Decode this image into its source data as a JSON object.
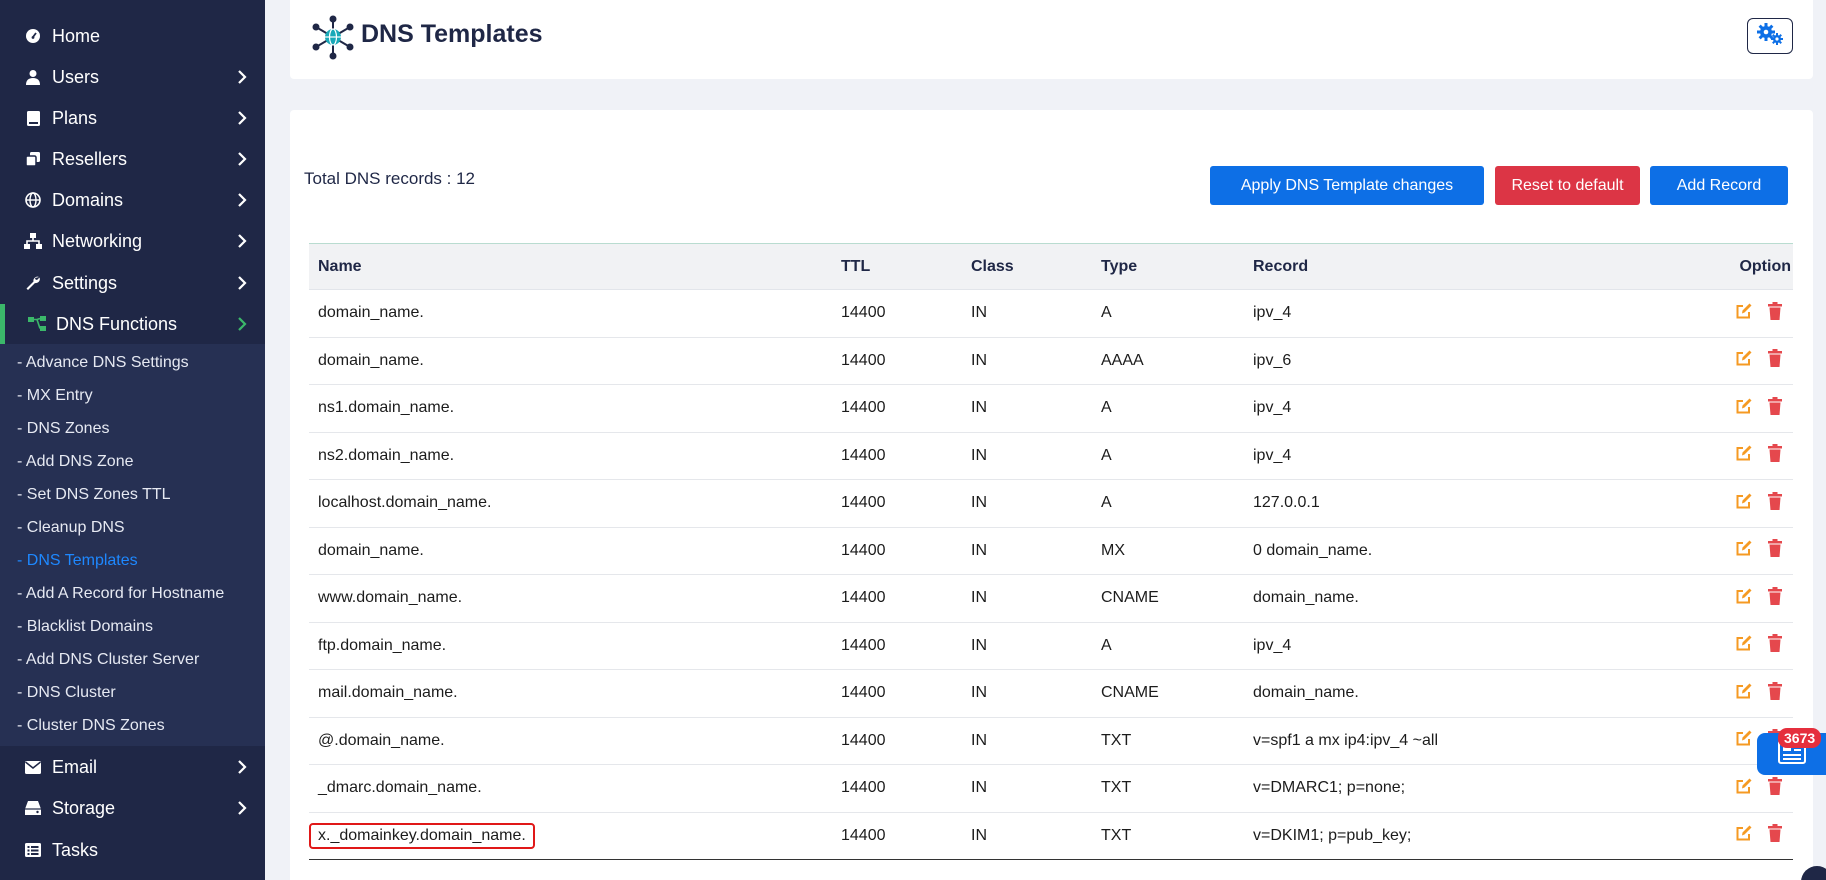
{
  "sidebar": {
    "items": [
      {
        "label": "Home",
        "icon": "dashboard-icon"
      },
      {
        "label": "Users",
        "icon": "user-icon"
      },
      {
        "label": "Plans",
        "icon": "book-icon"
      },
      {
        "label": "Resellers",
        "icon": "copy-icon"
      },
      {
        "label": "Domains",
        "icon": "globe-icon"
      },
      {
        "label": "Networking",
        "icon": "network-icon"
      },
      {
        "label": "Settings",
        "icon": "wrench-icon"
      },
      {
        "label": "DNS Functions",
        "icon": "sitemap-icon"
      },
      {
        "label": "Email",
        "icon": "envelope-icon"
      },
      {
        "label": "Storage",
        "icon": "hdd-icon"
      },
      {
        "label": "Tasks",
        "icon": "list-icon"
      }
    ],
    "dns_submenu": [
      "- Advance DNS Settings",
      "- MX Entry",
      "- DNS Zones",
      "- Add DNS Zone",
      "- Set DNS Zones TTL",
      "- Cleanup DNS",
      "- DNS Templates",
      "- Add A Record for Hostname",
      "- Blacklist Domains",
      "- Add DNS Cluster Server",
      "- DNS Cluster",
      "- Cluster DNS Zones"
    ],
    "current_submenu": "- DNS Templates"
  },
  "header": {
    "title": "DNS Templates"
  },
  "main": {
    "total_label": "Total DNS records : 12",
    "buttons": {
      "apply": "Apply DNS Template changes",
      "reset": "Reset to default",
      "add": "Add Record"
    },
    "table": {
      "columns": [
        "Name",
        "TTL",
        "Class",
        "Type",
        "Record",
        "Option"
      ],
      "rows": [
        {
          "name": "domain_name.",
          "ttl": "14400",
          "class": "IN",
          "type": "A",
          "record": "ipv_4"
        },
        {
          "name": "domain_name.",
          "ttl": "14400",
          "class": "IN",
          "type": "AAAA",
          "record": "ipv_6"
        },
        {
          "name": "ns1.domain_name.",
          "ttl": "14400",
          "class": "IN",
          "type": "A",
          "record": "ipv_4"
        },
        {
          "name": "ns2.domain_name.",
          "ttl": "14400",
          "class": "IN",
          "type": "A",
          "record": "ipv_4"
        },
        {
          "name": "localhost.domain_name.",
          "ttl": "14400",
          "class": "IN",
          "type": "A",
          "record": "127.0.0.1"
        },
        {
          "name": "domain_name.",
          "ttl": "14400",
          "class": "IN",
          "type": "MX",
          "record": "0 domain_name."
        },
        {
          "name": "www.domain_name.",
          "ttl": "14400",
          "class": "IN",
          "type": "CNAME",
          "record": "domain_name."
        },
        {
          "name": "ftp.domain_name.",
          "ttl": "14400",
          "class": "IN",
          "type": "A",
          "record": "ipv_4"
        },
        {
          "name": "mail.domain_name.",
          "ttl": "14400",
          "class": "IN",
          "type": "CNAME",
          "record": "domain_name."
        },
        {
          "name": "@.domain_name.",
          "ttl": "14400",
          "class": "IN",
          "type": "TXT",
          "record": "v=spf1 a mx ip4:ipv_4 ~all"
        },
        {
          "name": "_dmarc.domain_name.",
          "ttl": "14400",
          "class": "IN",
          "type": "TXT",
          "record": "v=DMARC1; p=none;"
        },
        {
          "name": "x._domainkey.domain_name.",
          "ttl": "14400",
          "class": "IN",
          "type": "TXT",
          "record": "v=DKIM1; p=pub_key;"
        }
      ]
    }
  },
  "float_widget": {
    "badge": "3673"
  },
  "colors": {
    "sidebar_bg": "#1f2746",
    "primary": "#0d6fe6",
    "danger": "#dc3545",
    "edit_icon": "#f59a23",
    "delete_icon": "#e5484d",
    "active_accent": "#3bb86a"
  }
}
